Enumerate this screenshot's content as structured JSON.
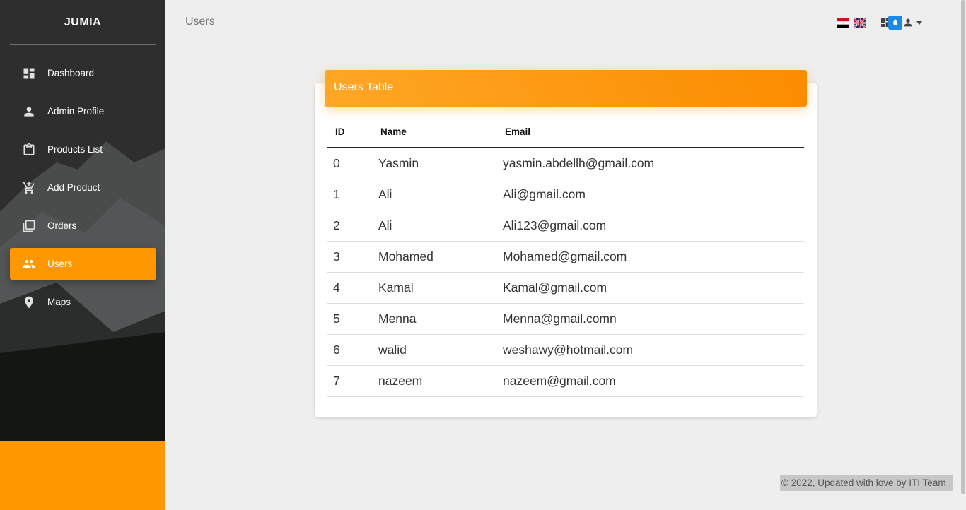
{
  "sidebar": {
    "brand": "JUMIA",
    "items": [
      {
        "label": "Dashboard",
        "icon": "dashboard-icon",
        "active": false
      },
      {
        "label": "Admin Profile",
        "icon": "person-icon",
        "active": false
      },
      {
        "label": "Products List",
        "icon": "clipboard-icon",
        "active": false
      },
      {
        "label": "Add Product",
        "icon": "add-cart-icon",
        "active": false
      },
      {
        "label": "Orders",
        "icon": "library-icon",
        "active": false
      },
      {
        "label": "Users",
        "icon": "people-icon",
        "active": true
      },
      {
        "label": "Maps",
        "icon": "location-pin-icon",
        "active": false
      }
    ],
    "accent_color": "#ff9800"
  },
  "header": {
    "title": "Users"
  },
  "table": {
    "title": "Users Table",
    "columns": [
      "ID",
      "Name",
      "Email"
    ],
    "rows": [
      [
        "0",
        "Yasmin",
        "yasmin.abdellh@gmail.com"
      ],
      [
        "1",
        "Ali",
        "Ali@gmail.com"
      ],
      [
        "2",
        "Ali",
        "Ali123@gmail.com"
      ],
      [
        "3",
        "Mohamed",
        "Mohamed@gmail.com"
      ],
      [
        "4",
        "Kamal",
        "Kamal@gmail.com"
      ],
      [
        "5",
        "Menna",
        "Menna@gmail.comn"
      ],
      [
        "6",
        "walid",
        "weshawy@hotmail.com"
      ],
      [
        "7",
        "nazeem",
        "nazeem@gmail.com"
      ]
    ]
  },
  "footer": {
    "text": "© 2022, Updated with love by ITI Team ."
  }
}
